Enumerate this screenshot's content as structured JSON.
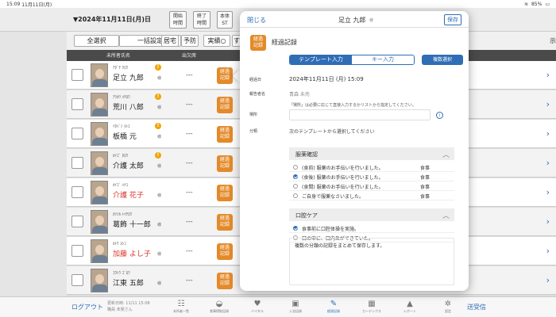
{
  "statusbar": {
    "time": "15:09",
    "date": "11月11日(月)",
    "wifi": "WiFi",
    "battery": "85%"
  },
  "topbar": {
    "date_title": "▼2024年11月11日(月)日",
    "btn_start": "開始\n時間",
    "btn_end": "終了\n時間",
    "btn_main": "本体\nST"
  },
  "filters": {
    "select_all": "全選択",
    "bulk": "一括設定",
    "kyotaku": "居宅",
    "yobo": "予防",
    "jisseki": "実績○",
    "more": "す",
    "display": "示"
  },
  "columns": {
    "name": "未所者氏名",
    "attendance": "出欠席"
  },
  "residents": [
    {
      "kana": "ｱﾀﾞﾁ ｸﾛｳ",
      "name": "足立 九郎",
      "sama": "様",
      "badge": "!",
      "attendance": "---",
      "record_icon": "経過\n記録"
    },
    {
      "kana": "ｱﾗｶﾜ ﾊﾁﾛｳ",
      "name": "荒川 八郎",
      "sama": "様",
      "badge": "!",
      "attendance": "---",
      "record_icon": "経過\n記録"
    },
    {
      "kana": "ｲﾀﾊﾞｼ ﾓﾄｴ",
      "name": "板橋 元",
      "sama": "様",
      "badge": "!",
      "attendance": "---",
      "record_icon": "経過\n記録"
    },
    {
      "kana": "ｶｲｺﾞ ﾀﾛｳ",
      "name": "介護 太郎",
      "sama": "様",
      "badge": "!",
      "attendance": "---",
      "record_icon": "経過\n記録"
    },
    {
      "kana": "ｶｲｺﾞ ﾊﾅｺ",
      "name": "介護 花子",
      "sama": "様",
      "badge": "",
      "attendance": "---",
      "record_icon": "経過\n記録"
    },
    {
      "kana": "ｶﾂｼｶ ﾄｲﾁﾛｳ",
      "name": "葛飾 十一郎",
      "sama": "様",
      "badge": "",
      "attendance": "---",
      "record_icon": "経過\n記録"
    },
    {
      "kana": "ｶﾄｳ ﾖｼｺ",
      "name": "加藤 よし子",
      "sama": "様",
      "badge": "",
      "attendance": "---",
      "record_icon": "経過\n記録"
    },
    {
      "kana": "ｺｳﾄｳ ｺﾞﾛｳ",
      "name": "江東 五郎",
      "sama": "様",
      "badge": "",
      "attendance": "---",
      "record_icon": "経過\n記録"
    }
  ],
  "bottombar": {
    "logout": "ログアウト",
    "last_updated": "更新日時: 11/11 15:08",
    "staff": "職員 未発さん",
    "tabs": [
      {
        "icon": "people-icon",
        "glyph": "☷",
        "label": "未所者一覧"
      },
      {
        "icon": "meal-icon",
        "glyph": "◒",
        "label": "食事摂取記録"
      },
      {
        "icon": "heart-icon",
        "glyph": "♥",
        "label": "バイタル"
      },
      {
        "icon": "bath-icon",
        "glyph": "▣",
        "label": "入浴記録"
      },
      {
        "icon": "record-icon",
        "glyph": "✎",
        "label": "経過記録"
      },
      {
        "icon": "card-icon",
        "glyph": "▦",
        "label": "カーデックス"
      },
      {
        "icon": "report-icon",
        "glyph": "▲",
        "label": "レポート"
      },
      {
        "icon": "settings-icon",
        "glyph": "✲",
        "label": "設定"
      }
    ],
    "resend": "送受信"
  },
  "popover": {
    "close": "閉じる",
    "title": "足立 九郎",
    "sama": "様",
    "save": "保存",
    "section_icon": "経過\n記録",
    "section_title": "経過記録",
    "seg_template": "テンプレート入力",
    "seg_key": "キー入力",
    "multi_select": "複数選択",
    "label_date": "経過日",
    "date_value": "2024年11月11日 (月) 15:09",
    "label_reporter": "報告者名",
    "reporter_value": "青森 未売",
    "label_place": "場所",
    "place_hint": "「場所」は必要に応じて直接入力するかリストから指定してください。",
    "label_category": "分類",
    "template_hint": "次のテンプレートから選択してください",
    "groups": [
      {
        "title": "服薬確認",
        "options": [
          {
            "text": "(食前) 服薬のお手伝いを行いました。",
            "tag": "食事",
            "checked": false
          },
          {
            "text": "(食後) 服薬のお手伝いを行いました。",
            "tag": "食事",
            "checked": true
          },
          {
            "text": "(食間) 服薬のお手伝いを行いました。",
            "tag": "食事",
            "checked": false
          },
          {
            "text": "ご自身で服薬なさいました。",
            "tag": "食事",
            "checked": false
          }
        ]
      },
      {
        "title": "口腔ケア",
        "options": [
          {
            "text": "食事前に口腔体操を実施。",
            "tag": "",
            "checked": true
          },
          {
            "text": "口の中に、口内炎ができていた。",
            "tag": "",
            "checked": false
          }
        ]
      }
    ],
    "summary": "複数の分類の記録をまとめて保存します。"
  },
  "colors": {
    "accent": "#2f6db5",
    "orange": "#e38a2a",
    "red_name": "#d9342b"
  }
}
